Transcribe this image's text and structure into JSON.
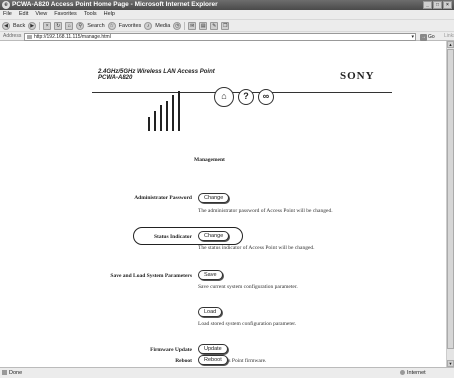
{
  "window": {
    "title": "PCWA-A820 Access Point Home Page - Microsoft Internet Explorer",
    "controls": {
      "minimize": "_",
      "maximize": "□",
      "close": "×"
    }
  },
  "menu": {
    "items": [
      "File",
      "Edit",
      "View",
      "Favorites",
      "Tools",
      "Help"
    ]
  },
  "toolbar": {
    "back": "Back",
    "search": "Search",
    "favorites": "Favorites",
    "media": "Media"
  },
  "address": {
    "label": "Address",
    "url": "http://192.168.11.115/manage.html",
    "go": "Go",
    "links": "Links"
  },
  "header": {
    "product_line": "2.4GHz/5GHz Wireless LAN Access Point",
    "model": "PCWA-A820",
    "brand": "SONY",
    "icons": [
      "home-icon",
      "help-icon",
      "link-icon"
    ]
  },
  "page": {
    "heading": "Management",
    "rows": [
      {
        "label": "Administrator Password",
        "button": "Change",
        "description": "The administrator password of Access Point will be changed."
      },
      {
        "label": "Status Indicator",
        "button": "Change",
        "description": "The status indicator of Access Point will be changed."
      },
      {
        "label": "Save and Load System Parameters",
        "button": "Save",
        "description": "Save current system configuration parameter."
      },
      {
        "label": "",
        "button": "Load",
        "description": "Load stored system configuration parameter."
      },
      {
        "label": "Firmware Update",
        "button": "Update",
        "description": "Update Access Point firmware."
      },
      {
        "label": "Reboot",
        "button": "Reboot",
        "description": ""
      }
    ]
  },
  "status": {
    "left": "Done",
    "right": "Internet"
  }
}
